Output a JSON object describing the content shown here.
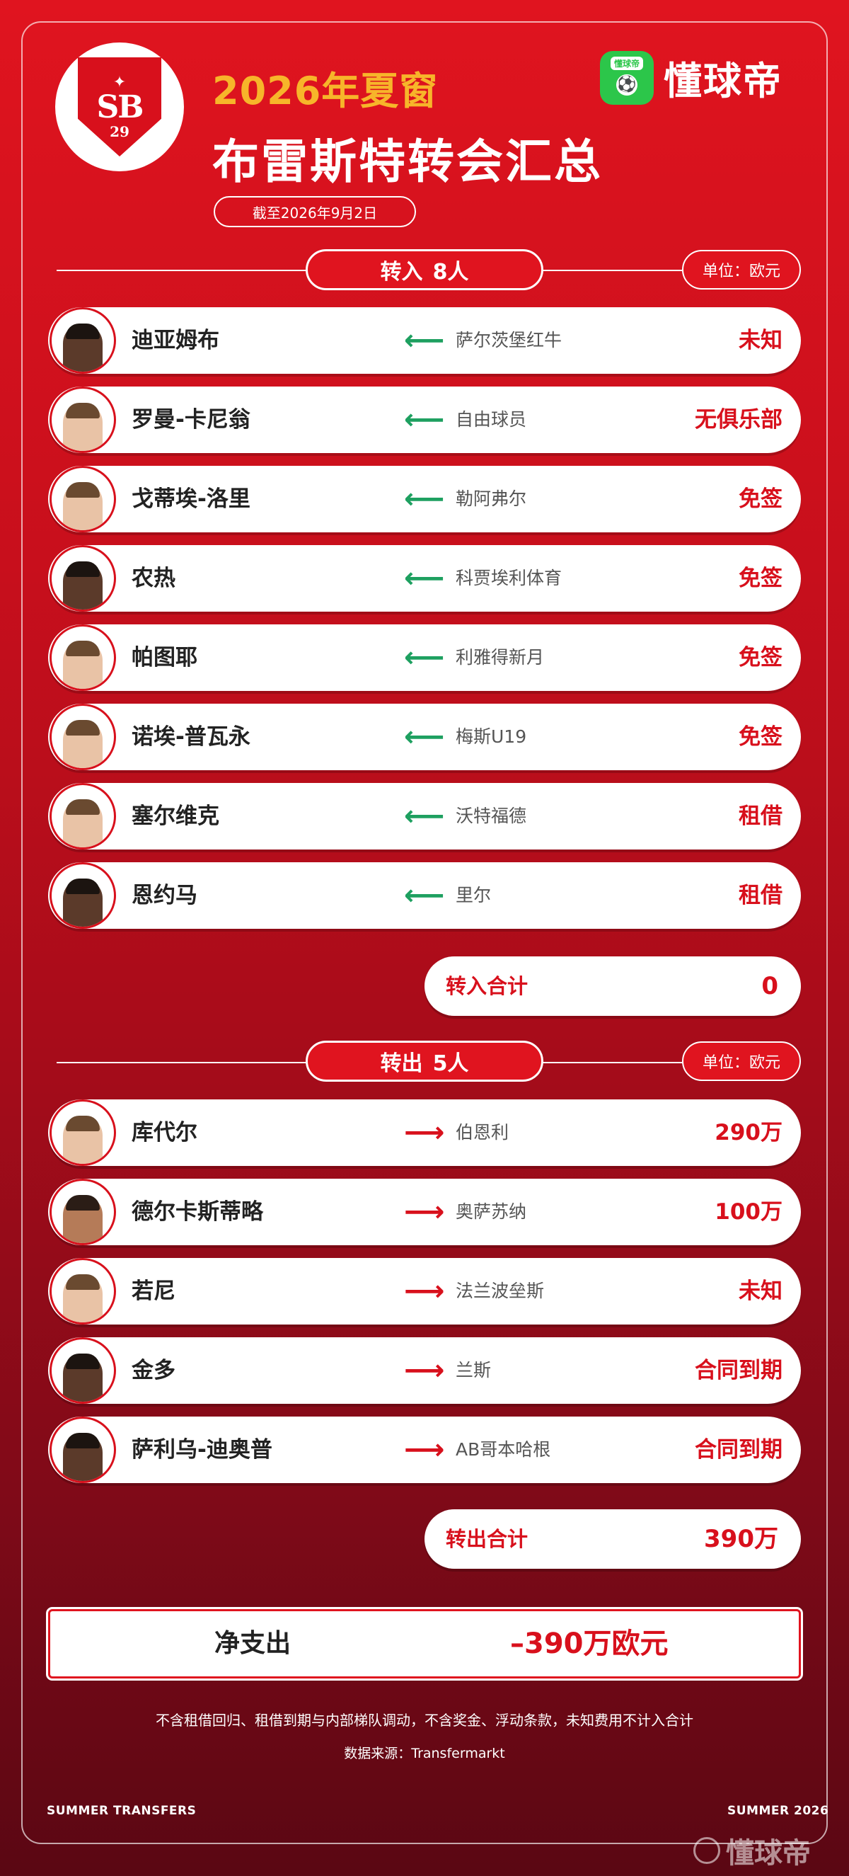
{
  "header": {
    "logo_text": "SB",
    "logo_number": "29",
    "season": "2026年夏窗",
    "title": "布雷斯特转会汇总",
    "date": "截至2026年9月2日",
    "brand": "懂球帝",
    "brand_icon_tag": "懂球帝"
  },
  "incoming": {
    "label": "转入",
    "count": "8人",
    "unit": "单位：欧元",
    "players": [
      {
        "name": "迪亚姆布",
        "club": "萨尔茨堡红牛",
        "fee": "未知"
      },
      {
        "name": "罗曼-卡尼翁",
        "club": "自由球员",
        "fee": "无俱乐部"
      },
      {
        "name": "戈蒂埃-洛里",
        "club": "勒阿弗尔",
        "fee": "免签"
      },
      {
        "name": "农热",
        "club": "科贾埃利体育",
        "fee": "免签"
      },
      {
        "name": "帕图耶",
        "club": "利雅得新月",
        "fee": "免签"
      },
      {
        "name": "诺埃-普瓦永",
        "club": "梅斯U19",
        "fee": "免签"
      },
      {
        "name": "塞尔维克",
        "club": "沃特福德",
        "fee": "租借"
      },
      {
        "name": "恩约马",
        "club": "里尔",
        "fee": "租借"
      }
    ],
    "total_label": "转入合计",
    "total_value": "0"
  },
  "outgoing": {
    "label": "转出",
    "count": "5人",
    "unit": "单位：欧元",
    "players": [
      {
        "name": "库代尔",
        "club": "伯恩利",
        "fee": "290万"
      },
      {
        "name": "德尔卡斯蒂略",
        "club": "奥萨苏纳",
        "fee": "100万"
      },
      {
        "name": "若尼",
        "club": "法兰波垒斯",
        "fee": "未知"
      },
      {
        "name": "金多",
        "club": "兰斯",
        "fee": "合同到期"
      },
      {
        "name": "萨利乌-迪奥普",
        "club": "AB哥本哈根",
        "fee": "合同到期"
      }
    ],
    "total_label": "转出合计",
    "total_value": "390万"
  },
  "net": {
    "label": "净支出",
    "value": "–390万欧元"
  },
  "notes": {
    "disclaimer": "不含租借回归、租借到期与内部梯队调动，不含奖金、浮动条款，未知费用不计入合计",
    "source": "数据来源：Transfermarkt"
  },
  "footer": {
    "left": "SUMMER TRANSFERS",
    "right": "SUMMER 2026",
    "watermark": "懂球帝"
  },
  "colors": {
    "primary_red": "#e0141f",
    "accent_gold": "#f7b52a",
    "arrow_in": "#1ea060",
    "arrow_out": "#d8101c",
    "brand_green": "#2cc64a"
  },
  "icons": {
    "arrow_in": "left-arrow-icon",
    "arrow_out": "right-arrow-icon"
  }
}
